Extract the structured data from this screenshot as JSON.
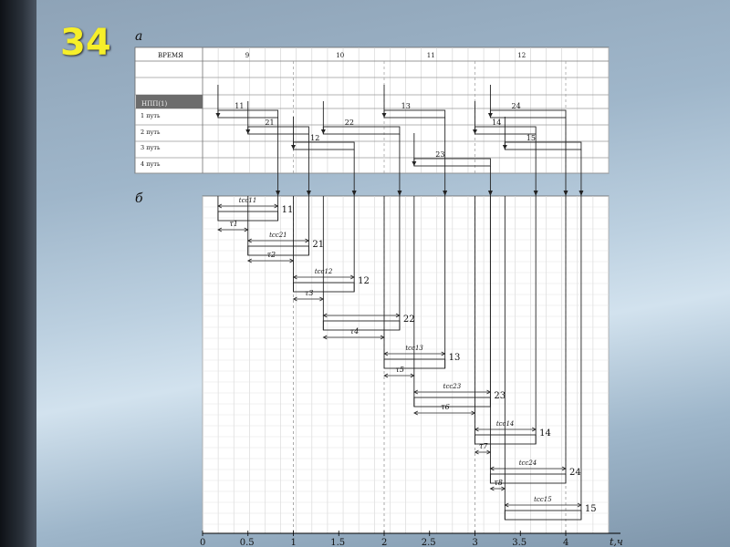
{
  "slide": {
    "number": "34",
    "label_a": "а",
    "label_b": "б"
  },
  "table": {
    "header": "ВРЕМЯ",
    "hours": [
      "9",
      "10",
      "11",
      "12"
    ],
    "section": "НПП(1)",
    "rows": [
      "1 путь",
      "2 путь",
      "3 путь",
      "4 путь"
    ]
  },
  "trains": [
    {
      "id": "11",
      "track": 1,
      "arrive": 0.17,
      "depart": 0.83,
      "tau": ""
    },
    {
      "id": "21",
      "track": 2,
      "arrive": 0.5,
      "depart": 1.17,
      "tau": "τ1"
    },
    {
      "id": "12",
      "track": 3,
      "arrive": 1.0,
      "depart": 1.67,
      "tau": "τ2"
    },
    {
      "id": "22",
      "track": 2,
      "arrive": 1.33,
      "depart": 2.17,
      "tau": "τ3"
    },
    {
      "id": "13",
      "track": 1,
      "arrive": 2.0,
      "depart": 2.67,
      "tau": "τ4"
    },
    {
      "id": "23",
      "track": 4,
      "arrive": 2.33,
      "depart": 3.17,
      "tau": "τ5"
    },
    {
      "id": "14",
      "track": 2,
      "arrive": 3.0,
      "depart": 3.67,
      "tau": "τ6"
    },
    {
      "id": "24",
      "track": 1,
      "arrive": 3.17,
      "depart": 4.0,
      "tau": "τ7"
    },
    {
      "id": "15",
      "track": 3,
      "arrive": 3.33,
      "depart": 4.17,
      "tau": "τ8"
    }
  ],
  "stay_labels": [
    "tсс11",
    "tсс21",
    "tсс12",
    "",
    "tсс13",
    "tсс23",
    "tсс14",
    "tсс24",
    "tсс15"
  ],
  "axis": {
    "ticks": [
      "0",
      "0.5",
      "1",
      "1.5",
      "2",
      "2.5",
      "3",
      "3.5",
      "4"
    ],
    "unit": "t,ч"
  }
}
